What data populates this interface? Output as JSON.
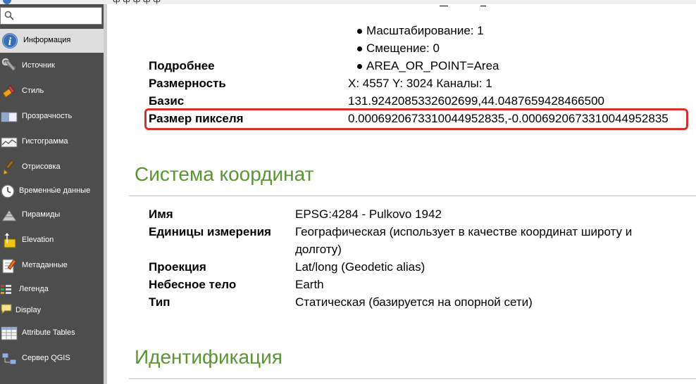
{
  "search": {
    "value": "",
    "placeholder": ""
  },
  "sidebar": {
    "items": [
      {
        "label": "Информация",
        "icon": "info-icon",
        "active": true
      },
      {
        "label": "Источник",
        "icon": "wrench-icon"
      },
      {
        "label": "Стиль",
        "icon": "paintbrush-icon"
      },
      {
        "label": "Прозрачность",
        "icon": "transparency-icon"
      },
      {
        "label": "Гистограмма",
        "icon": "histogram-icon"
      },
      {
        "label": "Отрисовка",
        "icon": "brush-icon"
      },
      {
        "label": "Временны́е данные",
        "icon": "clock-icon"
      },
      {
        "label": "Пирамиды",
        "icon": "pyramid-icon"
      },
      {
        "label": "Elevation",
        "icon": "elevation-icon"
      },
      {
        "label": "Метаданные",
        "icon": "metadata-icon"
      },
      {
        "label": "Легенда",
        "icon": "legend-icon"
      },
      {
        "label": "Display",
        "icon": "speech-bubble-icon"
      },
      {
        "label": "Attribute Tables",
        "icon": "table-icon"
      },
      {
        "label": "Сервер QGIS",
        "icon": "server-icon"
      }
    ]
  },
  "info": {
    "bullets": [
      "Масштабирование: 1",
      "Смещение: 0",
      "AREA_OR_POINT=Area"
    ],
    "rows": [
      {
        "label": "Подробнее",
        "value": ""
      },
      {
        "label": "Размерность",
        "value": "X: 4557 Y: 3024 Каналы: 1"
      },
      {
        "label": "Базис",
        "value": "131.9242085332602699,44.0487659428466500"
      },
      {
        "label": "Размер пикселя",
        "value": "0.0006920673310044952835,-0.0006920673310044952835",
        "highlighted": true
      }
    ]
  },
  "crs": {
    "title": "Система координат",
    "rows": [
      {
        "label": "Имя",
        "value": "EPSG:4284 - Pulkovo 1942"
      },
      {
        "label": "Единицы измерения",
        "value": "Географическая (использует в качестве координат широту и",
        "value2": "долготу)"
      },
      {
        "label": "Проекция",
        "value": "Lat/long (Geodetic alias)"
      },
      {
        "label": "Небесное тело",
        "value": "Earth"
      },
      {
        "label": "Тип",
        "value": "Статическая (базируется на опорной сети)"
      }
    ]
  },
  "identification": {
    "title": "Идентификация"
  },
  "colors": {
    "accent": "#589632",
    "highlight": "#d9302c",
    "sidebar_bg": "#4d4d4d"
  }
}
